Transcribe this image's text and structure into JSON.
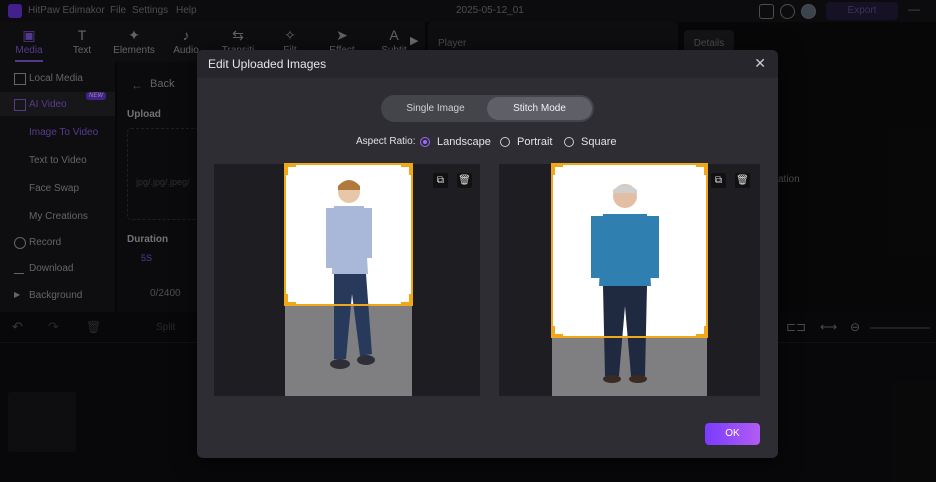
{
  "app": {
    "name": "HitPaw Edimakor",
    "menu": [
      "File",
      "Settings",
      "Help"
    ],
    "project_title": "2025-05-12_01",
    "export_label": "Export"
  },
  "toolbar": {
    "tabs": [
      {
        "label": "Media",
        "icon": "media-icon"
      },
      {
        "label": "Text",
        "icon": "text-icon"
      },
      {
        "label": "Elements",
        "icon": "elements-icon"
      },
      {
        "label": "Audio",
        "icon": "audio-icon"
      },
      {
        "label": "Transiti",
        "icon": "transition-icon"
      },
      {
        "label": "Filt",
        "icon": "filter-icon"
      },
      {
        "label": "Effect",
        "icon": "effect-icon"
      },
      {
        "label": "Subtit",
        "icon": "subtitle-icon"
      }
    ]
  },
  "player": {
    "label": "Player"
  },
  "details_tab": {
    "label": "Details"
  },
  "sidebar": {
    "items": [
      {
        "label": "Local Media"
      },
      {
        "label": "AI Video",
        "badge": "NEW"
      },
      {
        "label": "Image To Video"
      },
      {
        "label": "Text to Video"
      },
      {
        "label": "Face Swap"
      },
      {
        "label": "My Creations"
      },
      {
        "label": "Record"
      },
      {
        "label": "Download"
      },
      {
        "label": "Background"
      }
    ]
  },
  "panel": {
    "back_label": "Back",
    "upload_label": "Upload",
    "upload_hint": "jpg/.jpg/.jpeg/",
    "duration_label": "Duration",
    "duration_value": "5S",
    "credits": "0/2400",
    "side_text": "ation"
  },
  "timeline": {
    "split_label": "Split"
  },
  "dialog": {
    "title": "Edit Uploaded Images",
    "modes": [
      "Single Image",
      "Stitch Mode"
    ],
    "active_mode": "Stitch Mode",
    "aspect_label": "Aspect Ratio:",
    "aspect_options": [
      "Landscape",
      "Portrait",
      "Square"
    ],
    "aspect_selected": "Landscape",
    "ok_label": "OK"
  },
  "colors": {
    "accent": "#9c6bff",
    "selection": "#f0a818",
    "ok_gradient_start": "#7a3cff",
    "ok_gradient_end": "#b15cf2"
  }
}
